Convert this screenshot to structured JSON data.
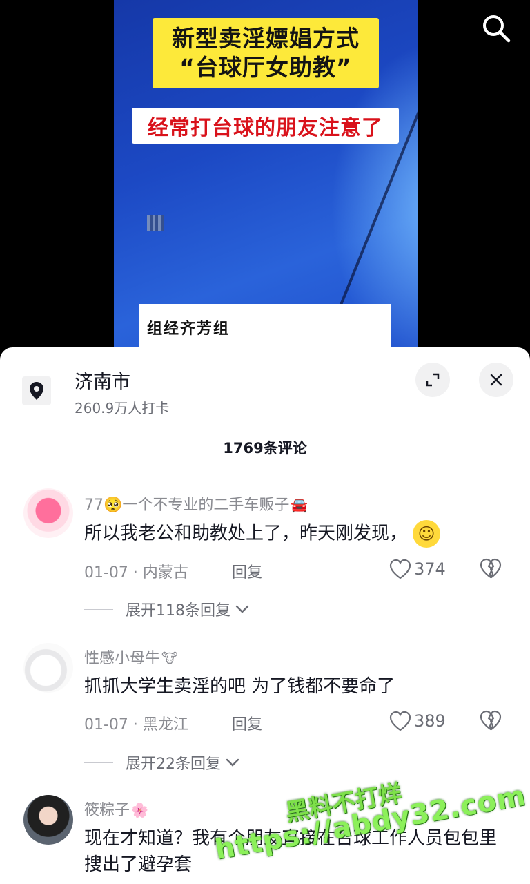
{
  "video": {
    "title_line1": "新型卖淫嫖娼方式",
    "title_line2": "“台球厅女助教”",
    "subtitle": "经常打台球的朋友注意了",
    "overlay_text": "组经齐芳组"
  },
  "location": {
    "name": "济南市",
    "checkins": "260.9万人打卡"
  },
  "comments_header": "1769条评论",
  "comments": [
    {
      "nickname": "77🥺一个不专业的二手车贩子",
      "nickname_emoji": "🚘",
      "text": "所以我老公和助教处上了，昨天刚发现，",
      "emoji": "☺",
      "date": "01-07 · 内蒙古",
      "reply": "回复",
      "likes": "374",
      "expand": "展开118条回复"
    },
    {
      "nickname": "性感小母牛",
      "nickname_emoji": "🐮",
      "text": "抓抓大学生卖淫的吧  为了钱都不要命了",
      "date": "01-07 · 黑龙江",
      "reply": "回复",
      "likes": "389",
      "expand": "展开22条回复"
    },
    {
      "nickname": "筱粽子",
      "nickname_emoji": "🌸",
      "text": "现在才知道？我有个朋友直接在台球工作人员包包里搜出了避孕套"
    }
  ],
  "watermark": {
    "line1": "黑料不打烊",
    "line2": "https://abdy32.com"
  },
  "colors": {
    "title_bg": "#fde93a",
    "subtitle_red": "#d9121b",
    "video_blue": "#1c49c4",
    "watermark_green": "#7ee04a"
  }
}
